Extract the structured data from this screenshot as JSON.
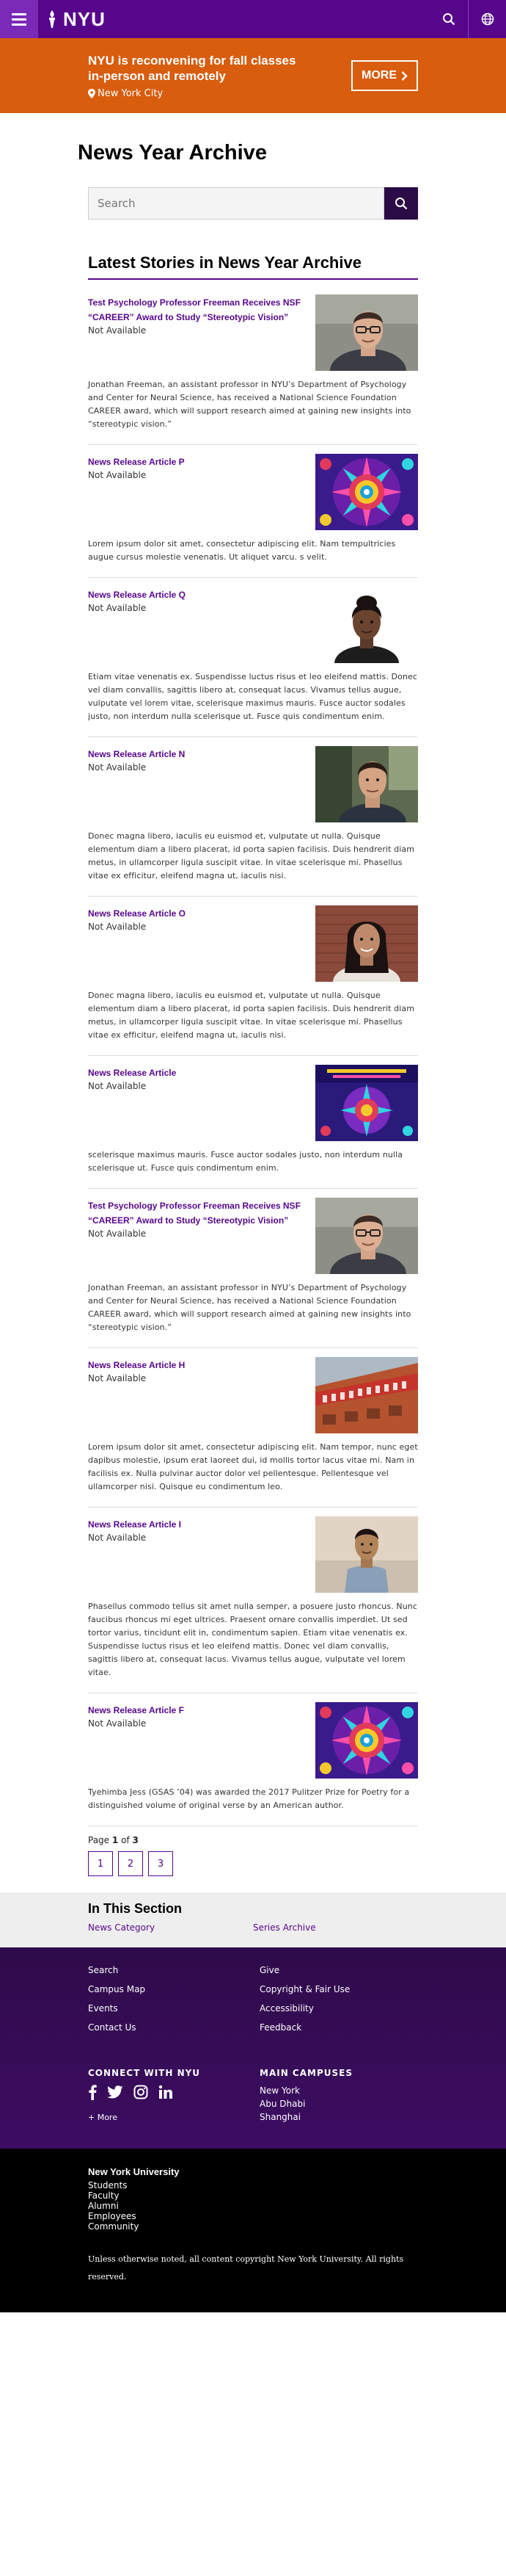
{
  "header": {
    "logo_text": "NYU",
    "brand_color": "#57068c"
  },
  "alert": {
    "title": "NYU is reconvening for fall classes in-person and remotely",
    "location": "New York City",
    "more_label": "MORE",
    "color": "#d85d0f"
  },
  "page": {
    "title": "News Year Archive",
    "search_placeholder": "Search",
    "section_title": "Latest Stories in News Year Archive"
  },
  "stories": [
    {
      "title": "Test Psychology Professor Freeman Receives NSF “CAREER” Award to Study “Stereotypic Vision”",
      "date": "Not Available",
      "summary": "Jonathan Freeman, an assistant professor in NYU’s Department of Psychology and Center for Neural Science, has received a National Science Foundation CAREER award, which will support research aimed at gaining new insights into “stereotypic vision.”",
      "image": "portrait-man-glasses"
    },
    {
      "title": "News Release Article P",
      "date": "Not Available",
      "summary": "Lorem ipsum dolor sit amet, consectetur adipiscing elit. Nam tempultricies augue cursus molestie venenatis. Ut aliquet varcu. s velit.",
      "image": "mandala-art"
    },
    {
      "title": "News Release Article Q",
      "date": "Not Available",
      "summary": "Etiam vitae venenatis ex. Suspendisse luctus risus et leo eleifend mattis. Donec vel diam convallis, sagittis libero at, consequat lacus. Vivamus tellus augue, vulputate vel lorem vitae, scelerisque maximus mauris. Fusce auctor sodales justo, non interdum nulla scelerisque ut. Fusce quis condimentum enim.",
      "image": "portrait-woman"
    },
    {
      "title": "News Release Article N",
      "date": "Not Available",
      "summary": "Donec magna libero, iaculis eu euismod et, vulputate ut nulla. Quisque elementum diam a libero placerat, id porta sapien facilisis. Duis hendrerit diam metus, in ullamcorper ligula suscipit vitae. In vitae scelerisque mi. Phasellus vitae ex efficitur, eleifend magna ut, iaculis nisi.",
      "image": "portrait-man-outdoor"
    },
    {
      "title": "News Release Article O",
      "date": "Not Available",
      "summary": "Donec magna libero, iaculis eu euismod et, vulputate ut nulla. Quisque elementum diam a libero placerat, id porta sapien facilisis. Duis hendrerit diam metus, in ullamcorper ligula suscipit vitae. In vitae scelerisque mi. Phasellus vitae ex efficitur, eleifend magna ut, iaculis nisi.",
      "image": "portrait-woman-brick"
    },
    {
      "title": "News Release Article",
      "date": "Not Available",
      "summary": "scelerisque maximus mauris. Fusce auctor sodales justo, non interdum nulla scelerisque ut. Fusce quis condimentum enim.",
      "image": "poster-art"
    },
    {
      "title": "Test Psychology Professor Freeman Receives NSF “CAREER” Award to Study “Stereotypic Vision”",
      "date": "Not Available",
      "summary": "Jonathan Freeman, an assistant professor in NYU’s Department of Psychology and Center for Neural Science, has received a National Science Foundation CAREER award, which will support research aimed at gaining new insights into “stereotypic vision.”",
      "image": "portrait-man-glasses"
    },
    {
      "title": "News Release Article H",
      "date": "Not Available",
      "summary": "Lorem ipsum dolor sit amet, consectetur adipiscing elit. Nam tempor, nunc eget dapibus molestie, ipsum erat laoreet dui, id mollis tortor lacus vitae mi. Nam in facilisis ex. Nulla pulvinar auctor dolor vel pellentesque. Pellentesque vel ullamcorper nisi. Quisque eu condimentum leo.",
      "image": "emergency-building"
    },
    {
      "title": "News Release Article I",
      "date": "Not Available",
      "summary": "Phasellus commodo tellus sit amet nulla semper, a posuere justo rhoncus. Nunc faucibus rhoncus mi eget ultrices. Praesent ornare convallis imperdiet. Ut sed tortor varius, tincidunt elit in, condimentum sapien. Etiam vitae venenatis ex. Suspendisse luctus risus et leo eleifend mattis. Donec vel diam convallis, sagittis libero at, consequat lacus. Vivamus tellus augue, vulputate vel lorem vitae.",
      "image": "portrait-man-shirt"
    },
    {
      "title": "News Release Article F",
      "date": "Not Available",
      "summary": "Tyehimba Jess (GSAS ’04) was awarded the 2017 Pulitzer Prize for Poetry for a distinguished volume of original verse by an American author.",
      "image": "mandala-art"
    }
  ],
  "pagination": {
    "prefix": "Page",
    "current": "1",
    "of_word": "of",
    "total": "3",
    "pages": [
      "1",
      "2",
      "3"
    ]
  },
  "in_section": {
    "title": "In This Section",
    "links": [
      "News Category",
      "Series Archive"
    ]
  },
  "footer": {
    "links": [
      "Search",
      "Give",
      "Campus Map",
      "Copyright & Fair Use",
      "Events",
      "Accessibility",
      "Contact Us",
      "Feedback"
    ],
    "connect_heading": "CONNECT WITH NYU",
    "more_label": "+ More",
    "social_icons": [
      "facebook-icon",
      "twitter-icon",
      "instagram-icon",
      "linkedin-icon"
    ],
    "campuses_heading": "MAIN CAMPUSES",
    "campuses": [
      "New York",
      "Abu Dhabi",
      "Shanghai"
    ],
    "university": "New York University",
    "audiences": [
      "Students",
      "Faculty",
      "Alumni",
      "Employees",
      "Community"
    ],
    "copyright": "Unless otherwise noted, all content copyright New York University. All rights reserved."
  }
}
